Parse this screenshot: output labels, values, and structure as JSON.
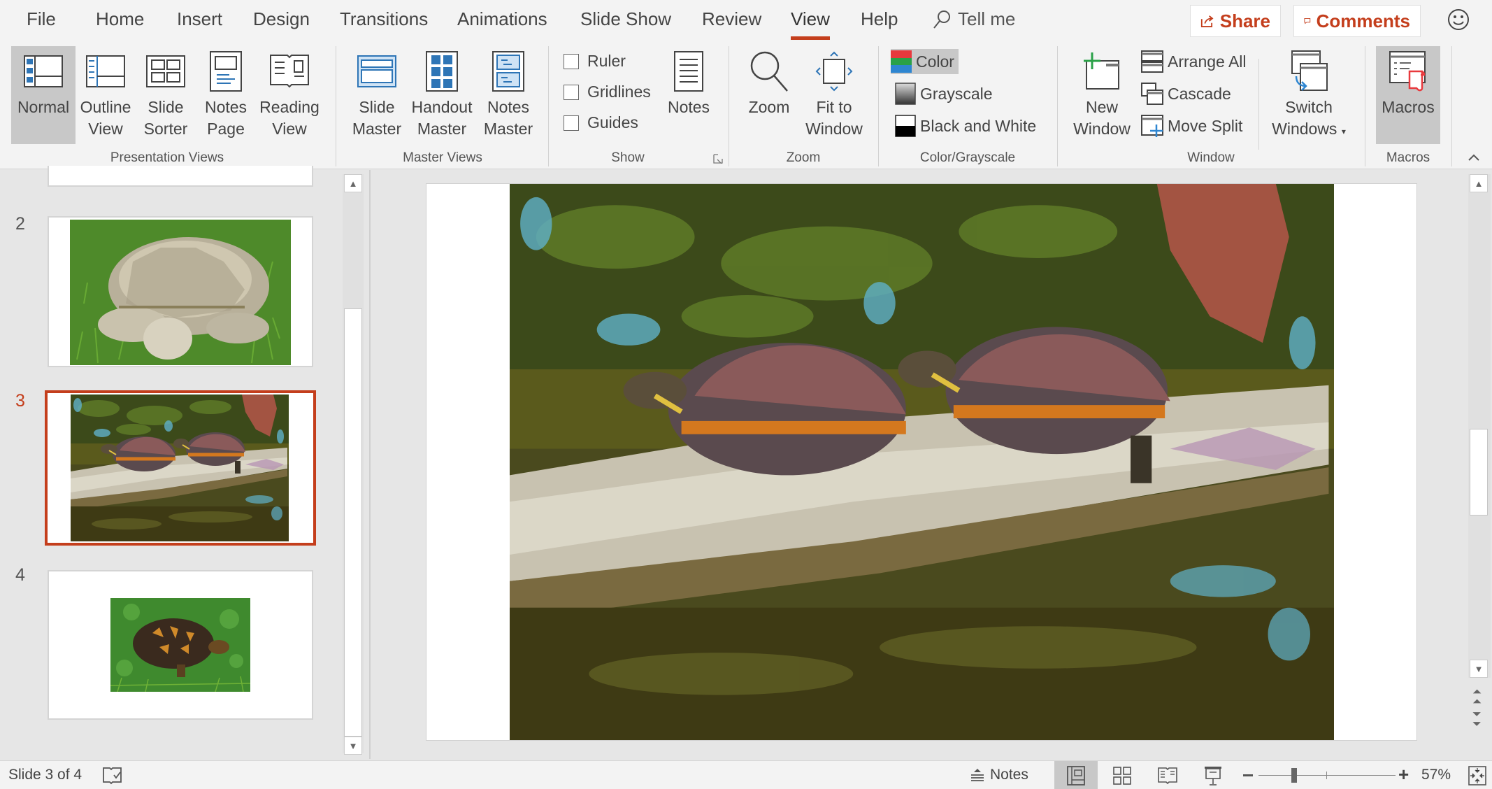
{
  "tabs": [
    "File",
    "Home",
    "Insert",
    "Design",
    "Transitions",
    "Animations",
    "Slide Show",
    "Review",
    "View",
    "Help"
  ],
  "active_tab": "View",
  "tell_me": "Tell me",
  "share_label": "Share",
  "comments_label": "Comments",
  "accent": "#c43e1c",
  "ribbon": {
    "presentation_views": {
      "group_label": "Presentation Views",
      "buttons": [
        {
          "line1": "Normal",
          "line2": "",
          "selected": true
        },
        {
          "line1": "Outline",
          "line2": "View"
        },
        {
          "line1": "Slide",
          "line2": "Sorter"
        },
        {
          "line1": "Notes",
          "line2": "Page"
        },
        {
          "line1": "Reading",
          "line2": "View"
        }
      ]
    },
    "master_views": {
      "group_label": "Master Views",
      "buttons": [
        {
          "line1": "Slide",
          "line2": "Master"
        },
        {
          "line1": "Handout",
          "line2": "Master"
        },
        {
          "line1": "Notes",
          "line2": "Master"
        }
      ]
    },
    "show": {
      "group_label": "Show",
      "checkboxes": [
        {
          "label": "Ruler",
          "checked": false
        },
        {
          "label": "Gridlines",
          "checked": false
        },
        {
          "label": "Guides",
          "checked": false
        }
      ],
      "notes_label": "Notes"
    },
    "zoom": {
      "group_label": "Zoom",
      "zoom_label": "Zoom",
      "fit_line1": "Fit to",
      "fit_line2": "Window"
    },
    "color": {
      "group_label": "Color/Grayscale",
      "options": [
        "Color",
        "Grayscale",
        "Black and White"
      ],
      "selected": "Color"
    },
    "window": {
      "group_label": "Window",
      "new_line1": "New",
      "new_line2": "Window",
      "arrange_all": "Arrange All",
      "cascade": "Cascade",
      "move_split": "Move Split",
      "switch_line1": "Switch",
      "switch_line2": "Windows"
    },
    "macros": {
      "group_label": "Macros",
      "label": "Macros"
    }
  },
  "slides": [
    {
      "number": "2",
      "image": "sulcata tortoise on grass"
    },
    {
      "number": "3",
      "image": "painted turtles basking on log",
      "selected": true
    },
    {
      "number": "4",
      "image": "box turtle on grass"
    }
  ],
  "status": {
    "slide_indicator": "Slide 3 of 4",
    "notes_label": "Notes",
    "zoom_percent": "57%",
    "zoom_value": 57
  }
}
